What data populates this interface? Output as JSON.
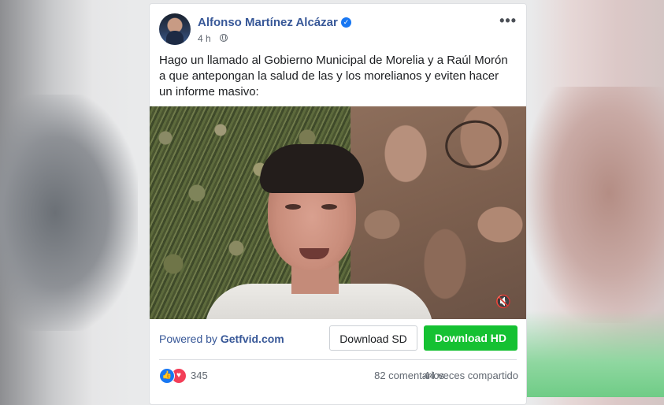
{
  "post": {
    "author": "Alfonso Martínez Alcázar",
    "time": "4 h",
    "message": "Hago un llamado al Gobierno Municipal de Morelia y a Raúl Morón a que antepongan la salud de las y los morelianos y eviten hacer un informe masivo:",
    "icons": {
      "verified": "verified-badge-icon",
      "privacy": "globe-icon",
      "more": "more-options-icon",
      "mute": "speaker-muted-icon"
    }
  },
  "video_bar": {
    "powered_prefix": "Powered by",
    "powered_brand": "Getfvid.com",
    "download_sd": "Download SD",
    "download_hd": "Download HD",
    "hd_color": "#15c132"
  },
  "stats": {
    "reactions": "345",
    "comments": "82 comentarios",
    "shares": "44 veces compartido"
  },
  "colors": {
    "link": "#385898",
    "like": "#1877f2",
    "love": "#f33e58"
  }
}
